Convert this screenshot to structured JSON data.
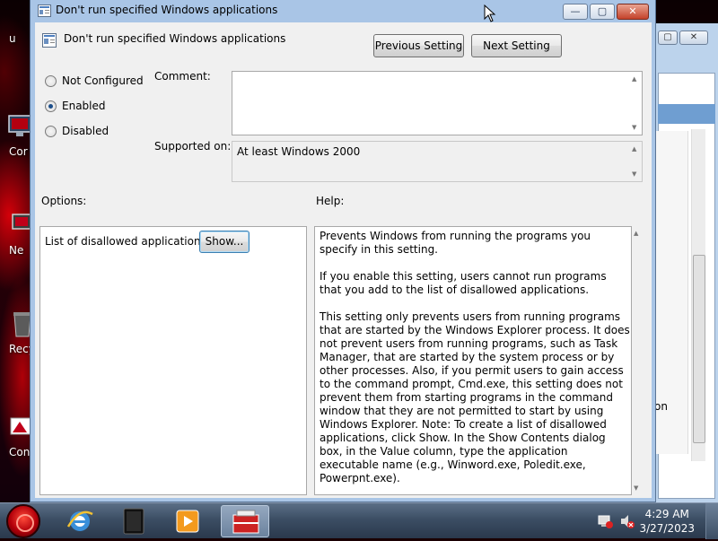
{
  "window": {
    "title": "Don't run specified Windows applications",
    "min_glyph": "—",
    "max_glyph": "▢",
    "close_glyph": "✕"
  },
  "header": {
    "title": "Don't run specified Windows applications",
    "previous_setting": "Previous Setting",
    "next_setting": "Next Setting"
  },
  "state_options": [
    {
      "label": "Not Configured",
      "selected": false
    },
    {
      "label": "Enabled",
      "selected": true
    },
    {
      "label": "Disabled",
      "selected": false
    }
  ],
  "comment": {
    "label": "Comment:",
    "value": ""
  },
  "supported_on": {
    "label": "Supported on:",
    "value": "At least Windows 2000"
  },
  "options": {
    "label": "Options:",
    "list_label": "List of disallowed applications",
    "show_button": "Show..."
  },
  "help": {
    "label": "Help:",
    "paragraphs": [
      "Prevents Windows from running the programs you specify in this setting.",
      "If you enable this setting, users cannot run programs that you add to the list of disallowed applications.",
      "This setting only prevents users from running programs that are started by the Windows Explorer process. It does not prevent users from running programs, such as Task Manager, that are started by the system process or by other processes. Also, if you permit users to gain access to the command prompt, Cmd.exe, this setting does not prevent them from starting programs in the command window that they are not permitted to start by using Windows Explorer. Note: To create a list of disallowed applications, click Show. In the Show Contents dialog box, in the Value column, type the application executable name (e.g., Winword.exe, Poledit.exe, Powerpnt.exe)."
    ]
  },
  "desktop": {
    "icons": [
      {
        "label": "u"
      },
      {
        "label": "Cor"
      },
      {
        "label": "Ne"
      },
      {
        "label": "Recy"
      },
      {
        "label": "Contr"
      }
    ]
  },
  "background_window": {
    "text": "on"
  },
  "taskbar": {
    "apps": [
      "internet-explorer",
      "media-center",
      "media-player",
      "group-policy-editor"
    ],
    "time": "4:29 AM",
    "date": "3/27/2023"
  },
  "colors": {
    "title_bar": "#a9c5e6",
    "dialog_bg": "#f0f0f0",
    "taskbar": "#3c4e64",
    "close_button": "#c4422a"
  }
}
